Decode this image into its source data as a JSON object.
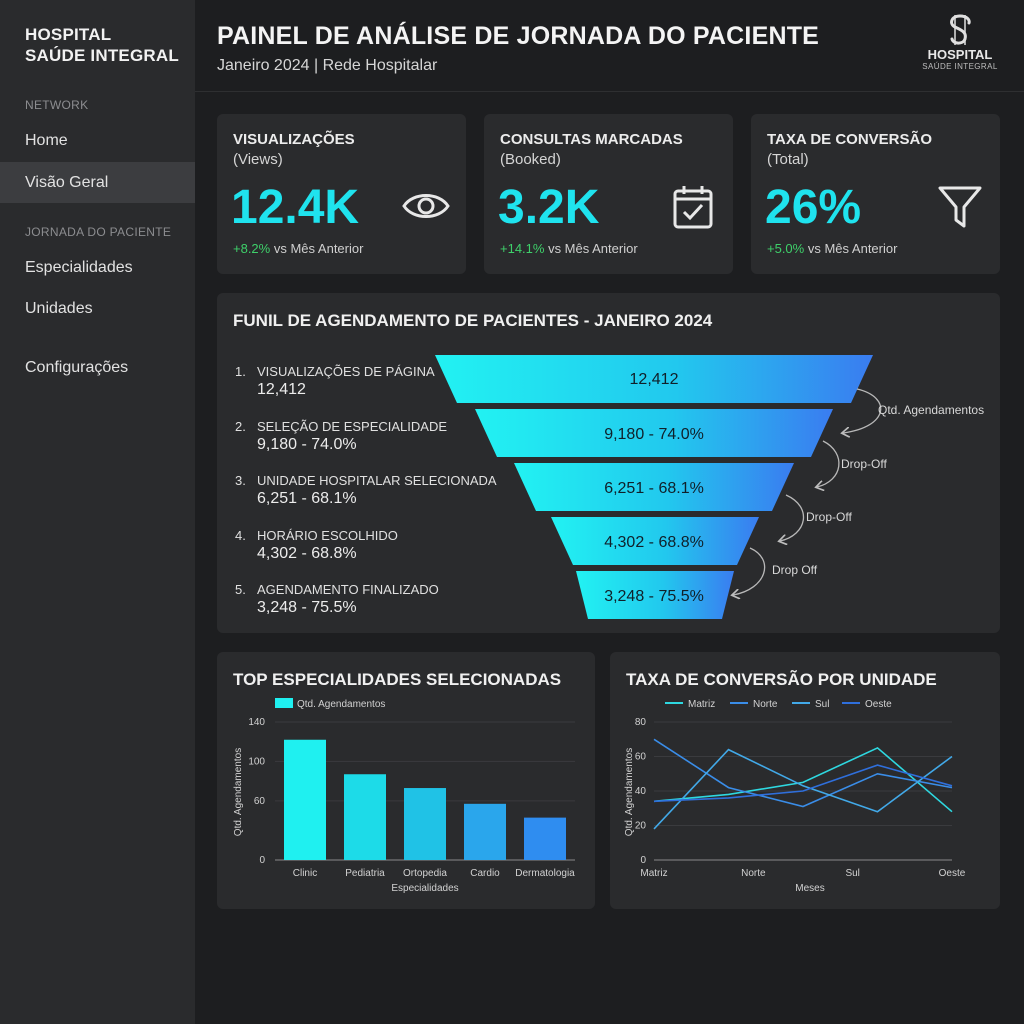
{
  "sidebar": {
    "brand_line1": "HOSPITAL",
    "brand_line2": "SAÚDE INTEGRAL",
    "section_network": "NETWORK",
    "items": [
      {
        "label": "Home"
      },
      {
        "label": "Visão Geral"
      },
      {
        "label": "Especialidades"
      },
      {
        "label": "Unidades"
      },
      {
        "label": "Configurações"
      }
    ],
    "section_journey": "JORNADA DO PACIENTE"
  },
  "header": {
    "title": "PAINEL DE ANÁLISE DE JORNADA DO PACIENTE",
    "subtitle": "Janeiro 2024 | Rede Hospitalar",
    "logo_title": "HOSPITAL",
    "logo_sub": "SAÚDE INTEGRAL"
  },
  "kpis": [
    {
      "title": "VISUALIZAÇÕES",
      "subtitle": "(Views)",
      "value": "12.4K",
      "delta": "+8.2%",
      "delta_suffix": " vs Mês Anterior",
      "icon": "eye-icon"
    },
    {
      "title": "CONSULTAS MARCADAS",
      "subtitle": "(Booked)",
      "value": "3.2K",
      "delta": "+14.1%",
      "delta_suffix": " vs Mês Anterior",
      "icon": "calendar-check-icon"
    },
    {
      "title": "TAXA DE CONVERSÃO",
      "subtitle": "(Total)",
      "value": "26%",
      "delta": "+5.0%",
      "delta_suffix": " vs Mês Anterior",
      "icon": "funnel-icon"
    }
  ],
  "funnel": {
    "title": "FUNIL DE AGENDAMENTO DE PACIENTES - JANEIRO 2024",
    "stages": [
      {
        "num": "1.",
        "name": "VISUALIZAÇÕES DE PÁGINA",
        "value": "12,412",
        "bar_label": "12,412"
      },
      {
        "num": "2.",
        "name": "SELEÇÃO DE ESPECIALIDADE",
        "value": "9,180 - 74.0%",
        "bar_label": "9,180 - 74.0%"
      },
      {
        "num": "3.",
        "name": "UNIDADE HOSPITALAR SELECIONADA",
        "value": "6,251 - 68.1%",
        "bar_label": "6,251 - 68.1%"
      },
      {
        "num": "4.",
        "name": "HORÁRIO ESCOLHIDO",
        "value": "4,302 - 68.8%",
        "bar_label": "4,302 - 68.8%"
      },
      {
        "num": "5.",
        "name": "AGENDAMENTO FINALIZADO",
        "value": "3,248 - 75.5%",
        "bar_label": "3,248 - 75.5%"
      }
    ],
    "arrow_labels": [
      "Qtd. Agendamentos",
      "Drop-Off",
      "Drop-Off",
      "Drop Off"
    ]
  },
  "colors": {
    "accent": "#1fe3ee",
    "positive": "#3ed06a",
    "card": "#2a2b2d",
    "background": "#1d1e20"
  },
  "bar_chart": {
    "title": "TOP ESPECIALIDADES SELECIONADAS"
  },
  "line_chart": {
    "title": "TAXA DE CONVERSÃO POR UNIDADE"
  },
  "chart_data": [
    {
      "type": "bar",
      "legend": "Qtd. Agendamentos",
      "categories": [
        "Clinic",
        "Pediatria",
        "Ortopedia",
        "Cardio",
        "Dermatologia"
      ],
      "series": [
        {
          "name": "Qtd. Agendamentos",
          "values": [
            122,
            87,
            73,
            57,
            43
          ]
        }
      ],
      "xlabel": "Especialidades",
      "ylabel": "Qtd. Agendamentos",
      "yticks": [
        "0",
        "60",
        "100",
        "140"
      ],
      "ylim": [
        0,
        140
      ],
      "colors": [
        "#1ff0f0",
        "#1ddbe8",
        "#20c2e6",
        "#2aa6ec",
        "#2f8df0"
      ],
      "legend_position": "top-left"
    },
    {
      "type": "line",
      "categories": [
        "Matriz",
        "Norte",
        "Sul",
        "Oeste"
      ],
      "series": [
        {
          "name": "Matriz",
          "color": "#2ed8e0",
          "values": [
            34,
            38,
            45,
            65,
            28
          ]
        },
        {
          "name": "Norte",
          "color": "#3a8de8",
          "values": [
            70,
            42,
            31,
            50,
            42
          ]
        },
        {
          "name": "Sul",
          "color": "#42a9e8",
          "values": [
            18,
            64,
            43,
            28,
            60
          ]
        },
        {
          "name": "Oeste",
          "color": "#2f6fdc",
          "values": [
            34,
            36,
            40,
            55,
            43
          ]
        }
      ],
      "xlabel": "Meses",
      "ylabel": "Qtd. Agendamentos",
      "yticks": [
        "0",
        "20",
        "40",
        "60",
        "80"
      ],
      "ylim": [
        0,
        80
      ],
      "legend_position": "top"
    }
  ]
}
